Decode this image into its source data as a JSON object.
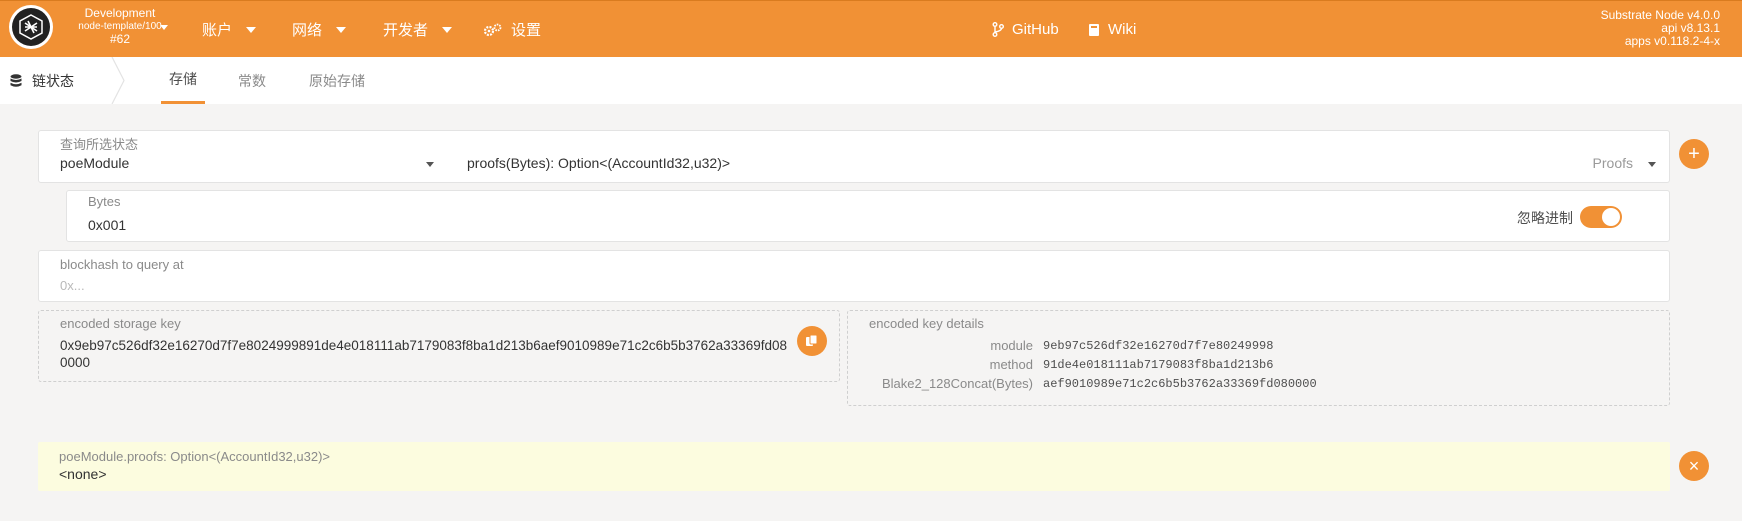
{
  "header": {
    "chain_name": "Development",
    "chain_runtime": "node-template/100",
    "block_number": "#62",
    "nav": [
      {
        "label": "账户",
        "has_dropdown": true
      },
      {
        "label": "网络",
        "has_dropdown": true
      },
      {
        "label": "开发者",
        "has_dropdown": true
      },
      {
        "label": "设置",
        "icon": "gears-icon"
      }
    ],
    "links": [
      {
        "label": "GitHub",
        "icon": "git-branch-icon"
      },
      {
        "label": "Wiki",
        "icon": "book-icon"
      }
    ],
    "version": {
      "node": "Substrate Node v4.0.0",
      "api": "api v8.13.1",
      "apps": "apps v0.118.2-4-x"
    }
  },
  "subnav": {
    "section_label": "链状态",
    "section_icon": "database-icon",
    "tabs": [
      {
        "label": "存储",
        "active": true
      },
      {
        "label": "常数",
        "active": false
      },
      {
        "label": "原始存储",
        "active": false
      }
    ]
  },
  "query": {
    "label": "查询所选状态",
    "module": "poeModule",
    "method": "proofs(Bytes): Option<(AccountId32,u32)>",
    "method_doc": "Proofs"
  },
  "param": {
    "label": "Bytes",
    "value": "0x001",
    "toggle_label": "忽略进制",
    "toggle_on": true
  },
  "blockhash": {
    "label": "blockhash to query at",
    "placeholder": "0x..."
  },
  "encoded_key": {
    "label": "encoded storage key",
    "line1": "0x9eb97c526df32e16270d7f7e8024999891de4e018111ab7179083f8ba1d213b6aef9010989e71c2c6b5b3762a33369fd08",
    "line2": "0000"
  },
  "key_details": {
    "label": "encoded key details",
    "rows": [
      {
        "key": "module",
        "value": "9eb97c526df32e16270d7f7e80249998"
      },
      {
        "key": "method",
        "value": "91de4e018111ab7179083f8ba1d213b6"
      },
      {
        "key": "Blake2_128Concat(Bytes)",
        "value": "aef9010989e71c2c6b5b3762a33369fd080000"
      }
    ]
  },
  "result": {
    "label": "poeModule.proofs: Option<(AccountId32,u32)>",
    "value": "<none>"
  },
  "colors": {
    "accent": "#f19135",
    "result_bg": "#fcfcdf"
  }
}
